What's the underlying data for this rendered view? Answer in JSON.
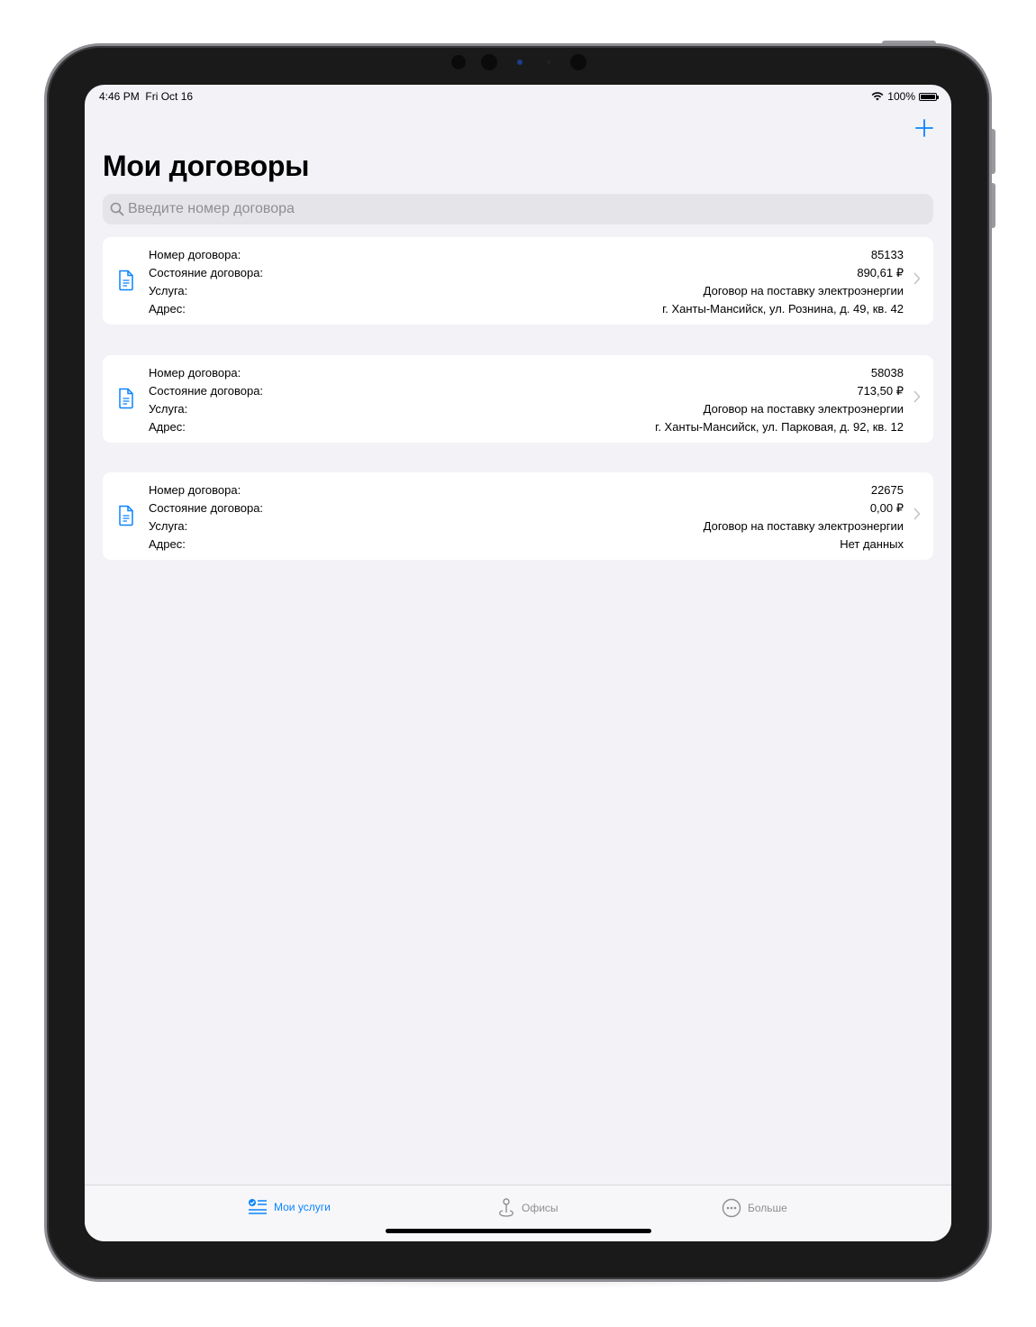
{
  "status_bar": {
    "time": "4:46 PM",
    "date": "Fri Oct 16",
    "battery": "100%"
  },
  "header": {
    "add_icon": "plus-icon",
    "title": "Мои договоры"
  },
  "search": {
    "icon": "search-icon",
    "placeholder": "Введите номер договора",
    "value": ""
  },
  "contracts": [
    {
      "number_label": "Номер договора:",
      "number": "85133",
      "state_label": "Состояние договора:",
      "state": "890,61 ₽",
      "service_label": "Услуга:",
      "service": "Договор на поставку электроэнергии",
      "address_label": "Адрес:",
      "address": "г. Ханты-Мансийск, ул. Рознина, д. 49, кв. 42"
    },
    {
      "number_label": "Номер договора:",
      "number": "58038",
      "state_label": "Состояние договора:",
      "state": "713,50 ₽",
      "service_label": "Услуга:",
      "service": "Договор на поставку электроэнергии",
      "address_label": "Адрес:",
      "address": "г. Ханты-Мансийск, ул. Парковая, д. 92, кв. 12"
    },
    {
      "number_label": "Номер договора:",
      "number": "22675",
      "state_label": "Состояние договора:",
      "state": "0,00 ₽",
      "service_label": "Услуга:",
      "service": "Договор на поставку электроэнергии",
      "address_label": "Адрес:",
      "address": "Нет данных"
    }
  ],
  "tabs": [
    {
      "label": "Мои услуги",
      "icon": "checklist-icon",
      "active": true
    },
    {
      "label": "Офисы",
      "icon": "map-pin-icon",
      "active": false
    },
    {
      "label": "Больше",
      "icon": "more-icon",
      "active": false
    }
  ],
  "colors": {
    "accent": "#0a84ff",
    "background": "#f2f2f7",
    "card": "#ffffff",
    "inactive": "#8e8e93"
  }
}
